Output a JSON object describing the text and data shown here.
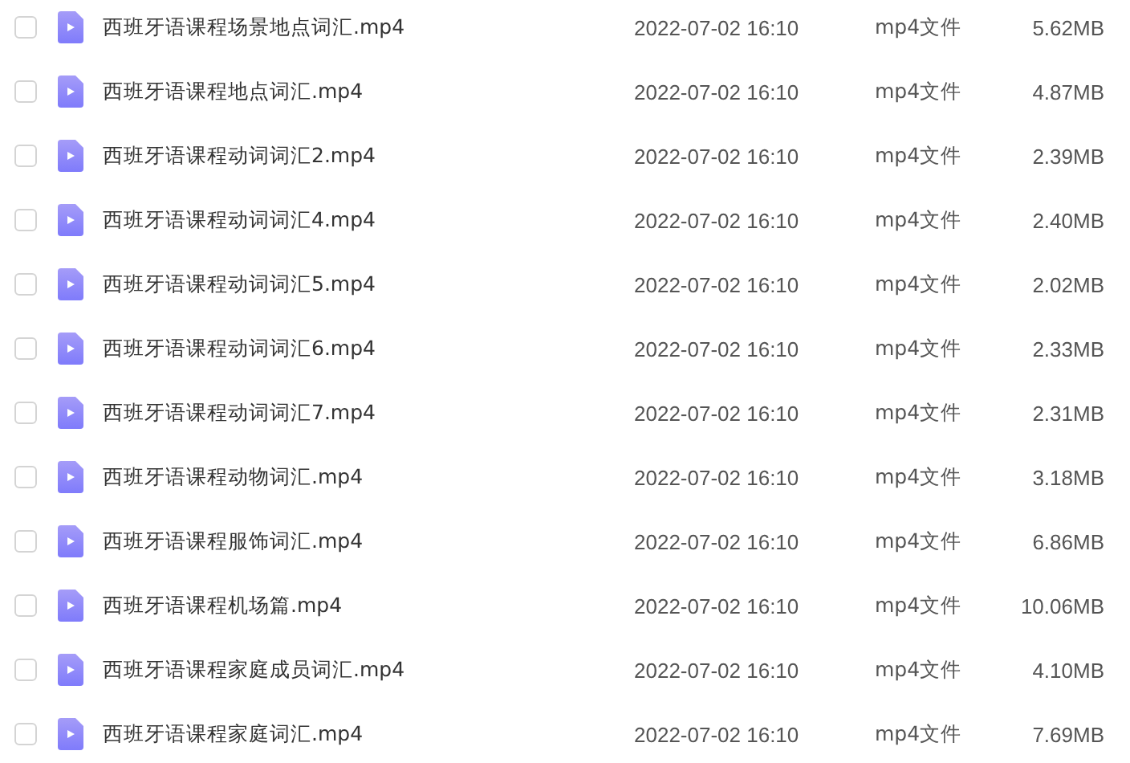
{
  "files": [
    {
      "name": "西班牙语课程场景地点词汇.mp4",
      "modified": "2022-07-02 16:10",
      "type": "mp4文件",
      "size": "5.62MB",
      "checked": false
    },
    {
      "name": "西班牙语课程地点词汇.mp4",
      "modified": "2022-07-02 16:10",
      "type": "mp4文件",
      "size": "4.87MB",
      "checked": false
    },
    {
      "name": "西班牙语课程动词词汇2.mp4",
      "modified": "2022-07-02 16:10",
      "type": "mp4文件",
      "size": "2.39MB",
      "checked": false
    },
    {
      "name": "西班牙语课程动词词汇4.mp4",
      "modified": "2022-07-02 16:10",
      "type": "mp4文件",
      "size": "2.40MB",
      "checked": false
    },
    {
      "name": "西班牙语课程动词词汇5.mp4",
      "modified": "2022-07-02 16:10",
      "type": "mp4文件",
      "size": "2.02MB",
      "checked": false
    },
    {
      "name": "西班牙语课程动词词汇6.mp4",
      "modified": "2022-07-02 16:10",
      "type": "mp4文件",
      "size": "2.33MB",
      "checked": false
    },
    {
      "name": "西班牙语课程动词词汇7.mp4",
      "modified": "2022-07-02 16:10",
      "type": "mp4文件",
      "size": "2.31MB",
      "checked": false
    },
    {
      "name": "西班牙语课程动物词汇.mp4",
      "modified": "2022-07-02 16:10",
      "type": "mp4文件",
      "size": "3.18MB",
      "checked": false
    },
    {
      "name": "西班牙语课程服饰词汇.mp4",
      "modified": "2022-07-02 16:10",
      "type": "mp4文件",
      "size": "6.86MB",
      "checked": false
    },
    {
      "name": "西班牙语课程机场篇.mp4",
      "modified": "2022-07-02 16:10",
      "type": "mp4文件",
      "size": "10.06MB",
      "checked": false
    },
    {
      "name": "西班牙语课程家庭成员词汇.mp4",
      "modified": "2022-07-02 16:10",
      "type": "mp4文件",
      "size": "4.10MB",
      "checked": false
    },
    {
      "name": "西班牙语课程家庭词汇.mp4",
      "modified": "2022-07-02 16:10",
      "type": "mp4文件",
      "size": "7.69MB",
      "checked": false
    }
  ]
}
